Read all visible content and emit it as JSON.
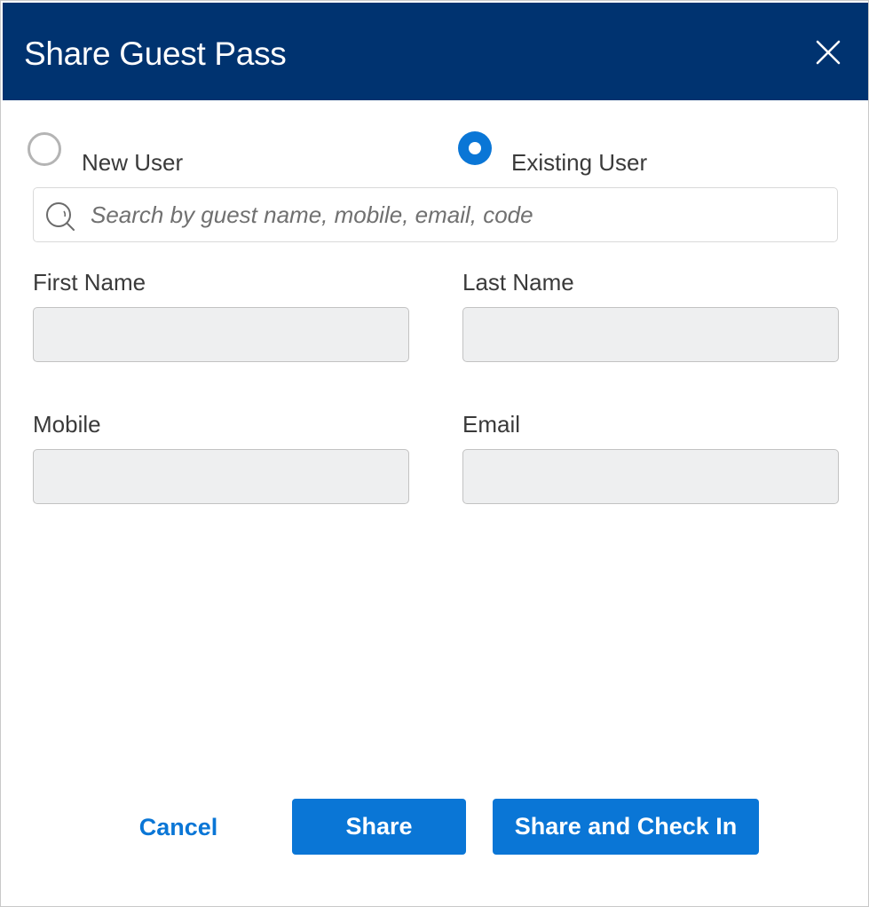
{
  "dialog": {
    "title": "Share Guest Pass",
    "close_icon": "close-icon"
  },
  "user_type": {
    "options": [
      {
        "label": "New User",
        "selected": false
      },
      {
        "label": "Existing User",
        "selected": true
      }
    ]
  },
  "search": {
    "icon": "search-icon",
    "placeholder": "Search by guest name, mobile, email, code",
    "value": ""
  },
  "fields": {
    "first_name": {
      "label": "First Name",
      "value": ""
    },
    "last_name": {
      "label": "Last Name",
      "value": ""
    },
    "mobile": {
      "label": "Mobile",
      "value": ""
    },
    "email": {
      "label": "Email",
      "value": ""
    }
  },
  "actions": {
    "cancel_label": "Cancel",
    "share_label": "Share",
    "share_checkin_label": "Share and Check In"
  },
  "colors": {
    "header_bg": "#003370",
    "accent": "#0a76d6",
    "disabled_field_bg": "#eeeff0"
  }
}
